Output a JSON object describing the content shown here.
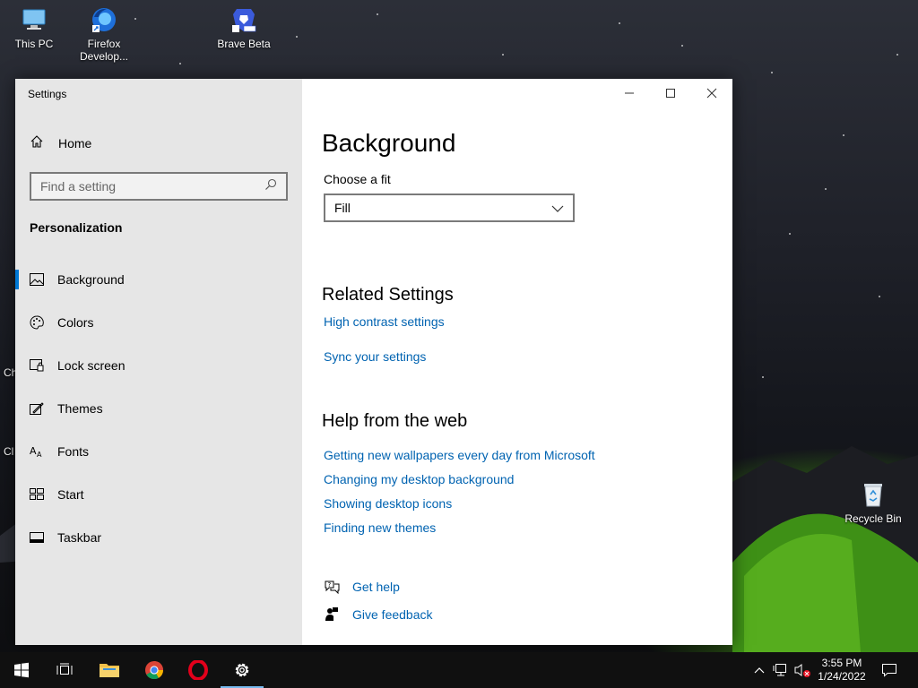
{
  "desktop": {
    "icons": [
      {
        "label": "This PC"
      },
      {
        "label": "Firefox Develop..."
      },
      {
        "label": "Brave Beta"
      },
      {
        "label": "Recycle Bin"
      }
    ],
    "edge_text_1": "Ch",
    "edge_text_2": "Cl"
  },
  "window": {
    "title": "Settings",
    "sidebar": {
      "home_label": "Home",
      "search_placeholder": "Find a setting",
      "section_title": "Personalization",
      "items": [
        {
          "label": "Background",
          "icon": "picture-icon",
          "active": true
        },
        {
          "label": "Colors",
          "icon": "palette-icon",
          "active": false
        },
        {
          "label": "Lock screen",
          "icon": "lock-screen-icon",
          "active": false
        },
        {
          "label": "Themes",
          "icon": "themes-icon",
          "active": false
        },
        {
          "label": "Fonts",
          "icon": "fonts-icon",
          "active": false
        },
        {
          "label": "Start",
          "icon": "start-icon",
          "active": false
        },
        {
          "label": "Taskbar",
          "icon": "taskbar-icon",
          "active": false
        }
      ]
    },
    "main": {
      "page_title": "Background",
      "fit_label": "Choose a fit",
      "fit_value": "Fill",
      "related_title": "Related Settings",
      "related_links": [
        "High contrast settings",
        "Sync your settings"
      ],
      "help_title": "Help from the web",
      "help_links": [
        "Getting new wallpapers every day from Microsoft",
        "Changing my desktop background",
        "Showing desktop icons",
        "Finding new themes"
      ],
      "get_help": "Get help",
      "give_feedback": "Give feedback"
    }
  },
  "taskbar": {
    "time": "3:55 PM",
    "date": "1/24/2022",
    "apps": [
      "start-icon",
      "task-view-icon",
      "file-explorer-icon",
      "chrome-icon",
      "opera-icon",
      "settings-icon"
    ]
  },
  "colors": {
    "accent": "#0078d4",
    "link": "#0063b1",
    "sidebar_bg": "#e6e6e6",
    "taskbar_bg": "#101010"
  }
}
